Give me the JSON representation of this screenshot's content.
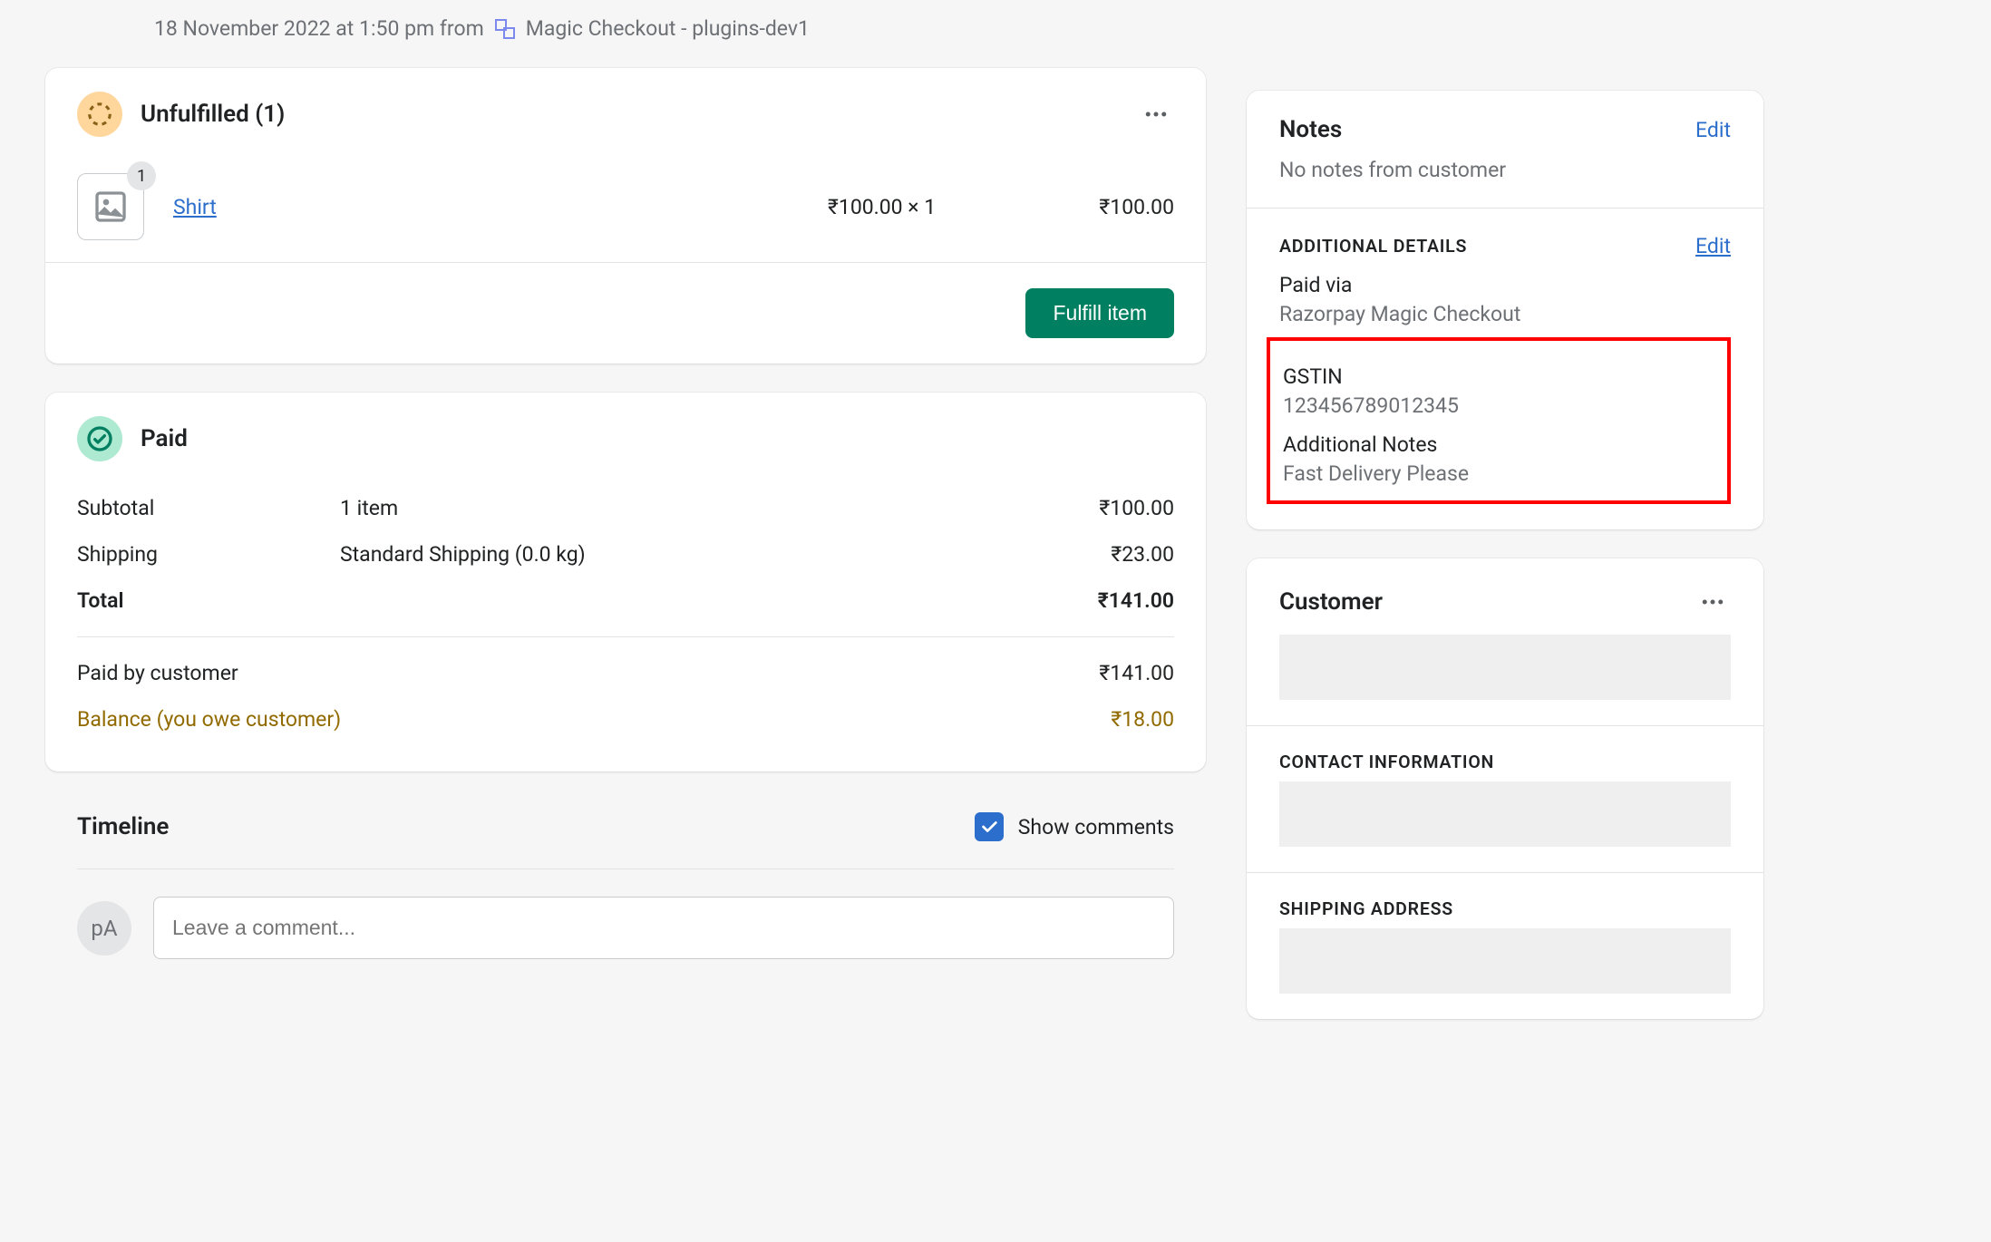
{
  "header": {
    "timestamp": "18 November 2022 at 1:50 pm from",
    "app_name": "Magic Checkout - plugins-dev1"
  },
  "fulfillment": {
    "title": "Unfulfilled (1)",
    "item": {
      "count": "1",
      "name": "Shirt",
      "qty_line": "₹100.00 × 1",
      "line_price": "₹100.00"
    },
    "fulfill_btn": "Fulfill item"
  },
  "paid": {
    "title": "Paid",
    "rows": {
      "subtotal_label": "Subtotal",
      "subtotal_desc": "1 item",
      "subtotal_val": "₹100.00",
      "shipping_label": "Shipping",
      "shipping_desc": "Standard Shipping (0.0 kg)",
      "shipping_val": "₹23.00",
      "total_label": "Total",
      "total_val": "₹141.00",
      "paid_label": "Paid by customer",
      "paid_val": "₹141.00",
      "balance_label": "Balance (you owe customer)",
      "balance_val": "₹18.00"
    }
  },
  "timeline": {
    "title": "Timeline",
    "show_comments": "Show comments",
    "avatar": "pA",
    "placeholder": "Leave a comment..."
  },
  "notes": {
    "title": "Notes",
    "edit": "Edit",
    "empty": "No notes from customer"
  },
  "details": {
    "title": "ADDITIONAL DETAILS",
    "edit": "Edit",
    "paid_via_label": "Paid via",
    "paid_via_value": "Razorpay Magic Checkout",
    "gstin_label": "GSTIN",
    "gstin_value": "123456789012345",
    "notes_label": "Additional Notes",
    "notes_value": "Fast Delivery Please"
  },
  "customer": {
    "title": "Customer",
    "contact_title": "CONTACT INFORMATION",
    "shipping_title": "SHIPPING ADDRESS"
  }
}
